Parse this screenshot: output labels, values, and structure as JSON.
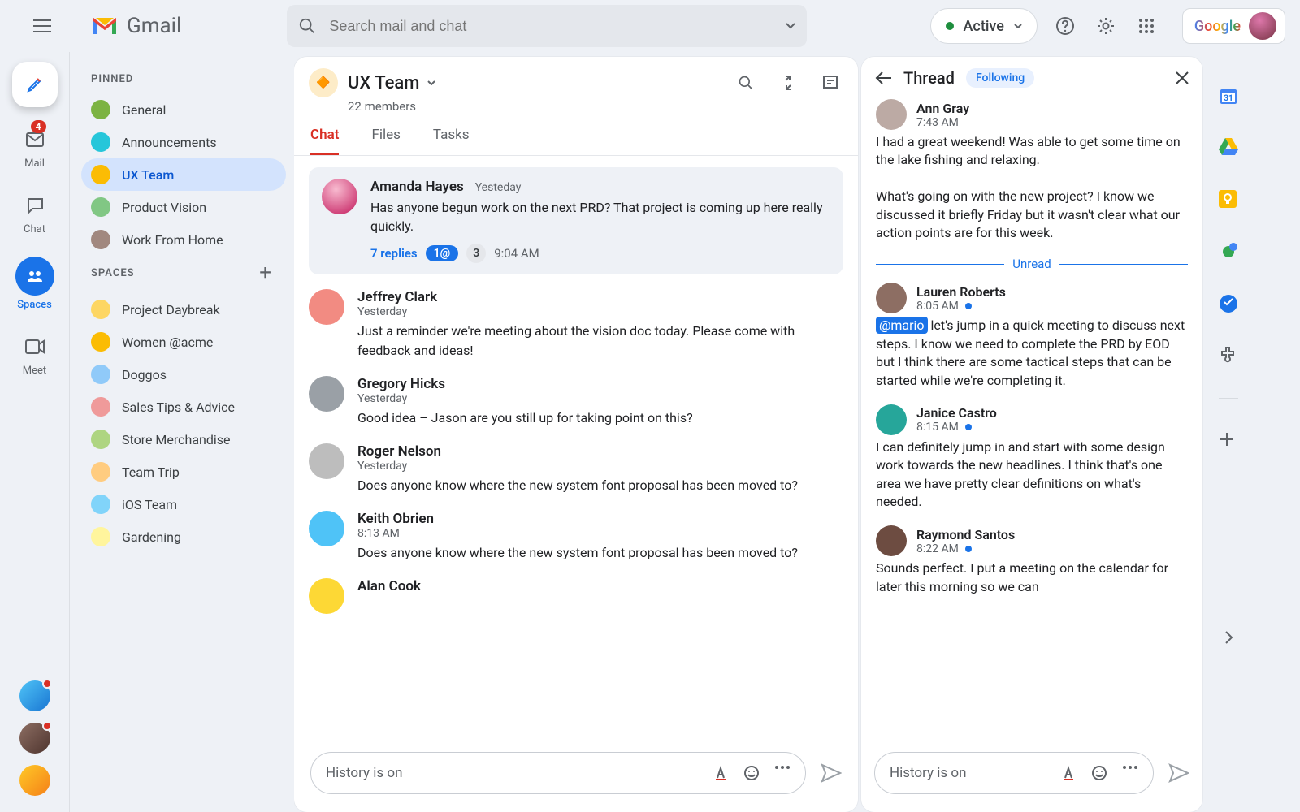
{
  "brand": {
    "name": "Gmail"
  },
  "search": {
    "placeholder": "Search mail and chat"
  },
  "status": {
    "label": "Active"
  },
  "google_logo_text": "Google",
  "rail": {
    "mail_badge": "4",
    "mail": "Mail",
    "chat": "Chat",
    "spaces": "Spaces",
    "meet": "Meet"
  },
  "sidebar": {
    "pinned_label": "PINNED",
    "spaces_label": "SPACES",
    "pinned": [
      {
        "label": "General",
        "color": "#7cb342"
      },
      {
        "label": "Announcements",
        "color": "#26c6da"
      },
      {
        "label": "UX Team",
        "color": "#fbbc04",
        "active": true
      },
      {
        "label": "Product Vision",
        "color": "#81c784"
      },
      {
        "label": "Work From Home",
        "color": "#a1887f"
      }
    ],
    "spaces": [
      {
        "label": "Project Daybreak",
        "color": "#fdd663"
      },
      {
        "label": "Women @acme",
        "color": "#fbbc04"
      },
      {
        "label": "Doggos",
        "color": "#90caf9"
      },
      {
        "label": "Sales Tips & Advice",
        "color": "#ef9a9a"
      },
      {
        "label": "Store Merchandise",
        "color": "#aed581"
      },
      {
        "label": "Team Trip",
        "color": "#ffcc80"
      },
      {
        "label": "iOS Team",
        "color": "#81d4fa"
      },
      {
        "label": "Gardening",
        "color": "#fff59d"
      }
    ]
  },
  "space": {
    "name": "UX Team",
    "members": "22 members",
    "tabs": {
      "chat": "Chat",
      "files": "Files",
      "tasks": "Tasks"
    }
  },
  "messages": {
    "card": {
      "author": "Amanda Hayes",
      "time": "Yesteday",
      "body": "Has anyone begun work on the next PRD? That project is coming up here really quickly.",
      "replies_label": "7 replies",
      "pill": "1@",
      "count": "3",
      "reply_time": "9:04 AM"
    },
    "list": [
      {
        "author": "Jeffrey Clark",
        "sub": "Yesterday",
        "body": "Just a reminder we're meeting about the vision doc today. Please come with feedback and ideas!",
        "color": "#f28b82"
      },
      {
        "author": "Gregory Hicks",
        "sub": "Yesterday",
        "body": "Good idea – Jason are you still up for taking point on this?",
        "color": "#9aa0a6"
      },
      {
        "author": "Roger Nelson",
        "sub": "Yesterday",
        "body": "Does anyone know where the new system font proposal has been moved to?",
        "color": "#bdbdbd"
      },
      {
        "author": "Keith Obrien",
        "sub": "8:13 AM",
        "body": "Does anyone know where the new system font proposal has been moved to?",
        "color": "#4fc3f7"
      },
      {
        "author": "Alan Cook",
        "sub": "",
        "body": "",
        "color": "#fdd835"
      }
    ]
  },
  "compose": {
    "placeholder": "History is on"
  },
  "thread": {
    "title": "Thread",
    "chip": "Following",
    "unread_label": "Unread",
    "items": [
      {
        "author": "Ann Gray",
        "time": "7:43 AM",
        "body": "I had a great weekend! Was able to get some time on the lake fishing and relaxing.\n\nWhat's going on with the new project? I know we discussed it briefly Friday but it wasn't clear what our action points are for this week.",
        "color": "#bcaaa4",
        "unread": false
      },
      {
        "author": "Lauren Roberts",
        "time": "8:05 AM",
        "mention": "@mario",
        "body": "let's jump in a quick meeting to discuss next steps. I know we need to complete the PRD by EOD but I think there are some tactical steps that can be started while we're completing it.",
        "color": "#8d6e63",
        "unread": true
      },
      {
        "author": "Janice Castro",
        "time": "8:15 AM",
        "body": "I can definitely jump in and start with some design work towards the new headlines. I think that's one area we have pretty clear definitions on what's needed.",
        "color": "#26a69a",
        "unread": true
      },
      {
        "author": "Raymond Santos",
        "time": "8:22 AM",
        "body": "Sounds perfect. I put a meeting on the calendar for later this morning so we can",
        "color": "#6d4c41",
        "unread": true
      }
    ]
  }
}
